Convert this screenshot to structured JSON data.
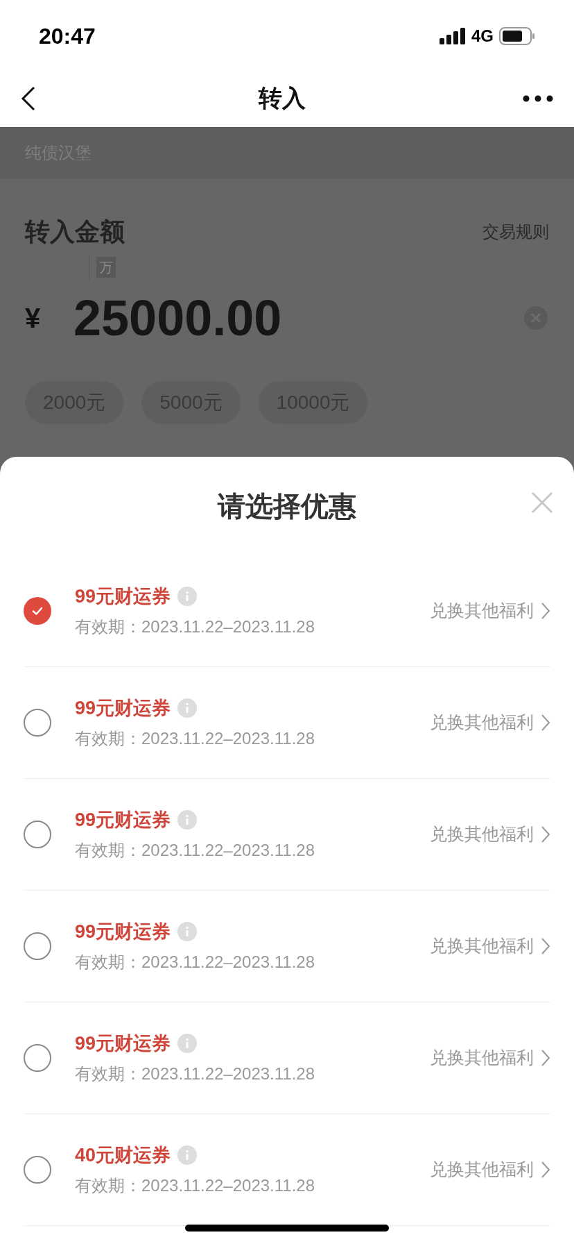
{
  "status_bar": {
    "time": "20:47",
    "network": "4G"
  },
  "nav": {
    "title": "转入"
  },
  "page": {
    "product": "纯债汉堡",
    "amount_label": "转入金额",
    "rules_link": "交易规则",
    "unit_hint": "万",
    "currency": "¥",
    "amount": "25000.00",
    "quick_amounts": [
      "2000元",
      "5000元",
      "10000元"
    ]
  },
  "sheet": {
    "title": "请选择优惠",
    "coupons": [
      {
        "name": "99元财运券",
        "validity": "有效期：2023.11.22–2023.11.28",
        "action": "兑换其他福利",
        "selected": true
      },
      {
        "name": "99元财运券",
        "validity": "有效期：2023.11.22–2023.11.28",
        "action": "兑换其他福利",
        "selected": false
      },
      {
        "name": "99元财运券",
        "validity": "有效期：2023.11.22–2023.11.28",
        "action": "兑换其他福利",
        "selected": false
      },
      {
        "name": "99元财运券",
        "validity": "有效期：2023.11.22–2023.11.28",
        "action": "兑换其他福利",
        "selected": false
      },
      {
        "name": "99元财运券",
        "validity": "有效期：2023.11.22–2023.11.28",
        "action": "兑换其他福利",
        "selected": false
      },
      {
        "name": "40元财运券",
        "validity": "有效期：2023.11.22–2023.11.28",
        "action": "兑换其他福利",
        "selected": false
      }
    ]
  }
}
